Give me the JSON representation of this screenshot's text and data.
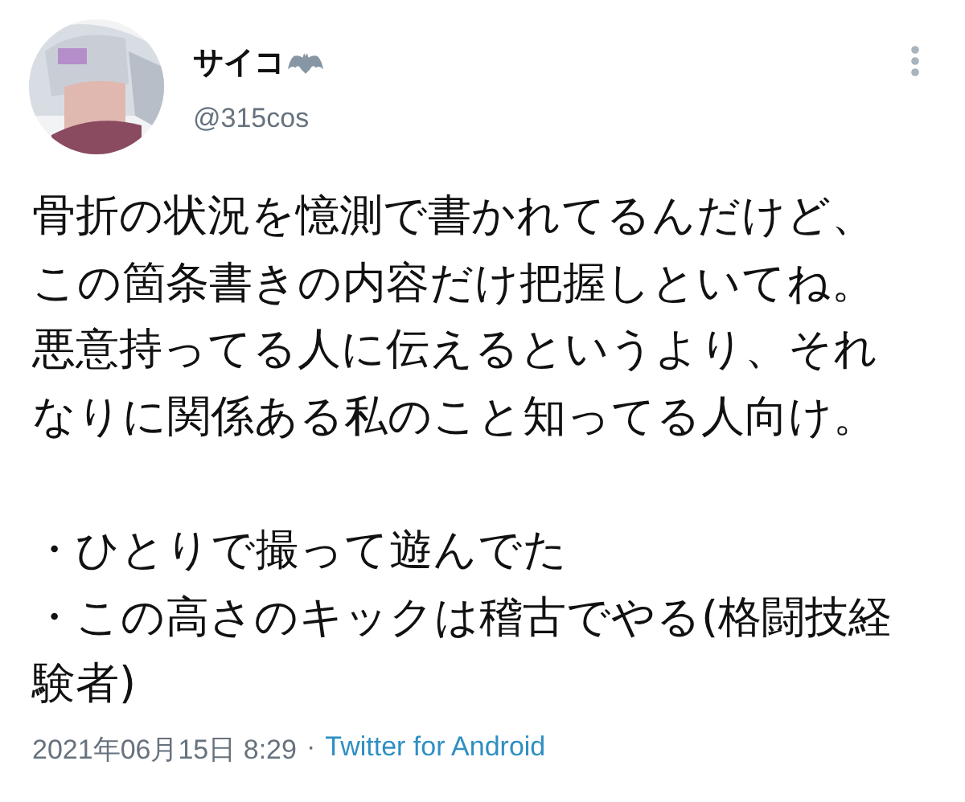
{
  "author": {
    "name": "サイコ",
    "handle": "@315cos"
  },
  "body": [
    {
      "kind": "line",
      "text": "骨折の状況を憶測で書かれてるんだけど、"
    },
    {
      "kind": "line",
      "text": "この箇条書きの内容だけ把握しといてね。"
    },
    {
      "kind": "line",
      "text": "悪意持ってる人に伝えるというより、それ"
    },
    {
      "kind": "line",
      "text": "なりに関係ある私のこと知ってる人向け。"
    },
    {
      "kind": "gap"
    },
    {
      "kind": "line",
      "text": "・ひとりで撮って遊んでた"
    },
    {
      "kind": "line",
      "text": "・この高さのキックは稽古でやる(格闘技経"
    },
    {
      "kind": "line",
      "text": "験者)"
    }
  ],
  "meta": {
    "timestamp": "2021年06月15日 8:29",
    "separator": "·",
    "source": "Twitter for Android"
  }
}
